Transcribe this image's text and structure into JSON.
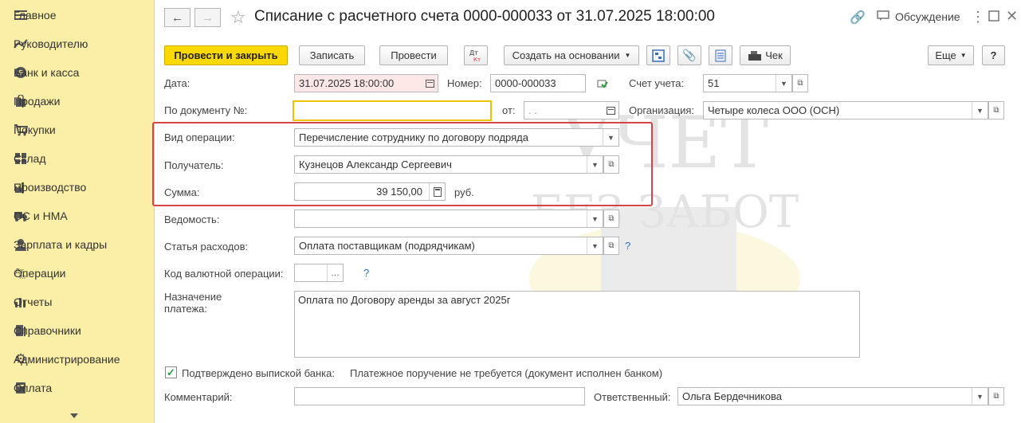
{
  "sidebar": {
    "items": [
      {
        "label": "Главное",
        "icon": "menu-icon"
      },
      {
        "label": "Руководителю",
        "icon": "trend-icon"
      },
      {
        "label": "Банк и касса",
        "icon": "ruble-coin-icon"
      },
      {
        "label": "Продажи",
        "icon": "bag-icon"
      },
      {
        "label": "Покупки",
        "icon": "cart-icon"
      },
      {
        "label": "Склад",
        "icon": "warehouse-icon"
      },
      {
        "label": "Производство",
        "icon": "factory-icon"
      },
      {
        "label": "ОС и НМА",
        "icon": "truck-icon"
      },
      {
        "label": "Зарплата и кадры",
        "icon": "person-icon"
      },
      {
        "label": "Операции",
        "icon": "dt-kt-icon"
      },
      {
        "label": "Отчеты",
        "icon": "bar-chart-icon"
      },
      {
        "label": "Справочники",
        "icon": "books-icon"
      },
      {
        "label": "Администрирование",
        "icon": "gear-icon"
      },
      {
        "label": "Оплата",
        "icon": "card-icon"
      }
    ]
  },
  "header": {
    "title": "Списание с расчетного счета 0000-000033 от 31.07.2025 18:00:00",
    "discuss_label": "Обсуждение"
  },
  "toolbar": {
    "post_close": "Провести и закрыть",
    "save": "Записать",
    "post": "Провести",
    "dtkt": "Дт Кт",
    "create_based": "Создать на основании",
    "check": "Чек",
    "more": "Еще",
    "help": "?"
  },
  "form": {
    "date_label": "Дата:",
    "date_value": "31.07.2025 18:00:00",
    "number_label": "Номер:",
    "number_value": "0000-000033",
    "account_label": "Счет учета:",
    "account_value": "51",
    "doc_no_label": "По документу №:",
    "doc_no_value": "",
    "from_label": "от:",
    "from_value": " .  .  ",
    "org_label": "Организация:",
    "org_value": "Четыре колеса ООО (ОСН)",
    "op_type_label": "Вид операции:",
    "op_type_value": "Перечисление сотруднику по договору подряда",
    "recipient_label": "Получатель:",
    "recipient_value": "Кузнецов Александр Сергеевич",
    "sum_label": "Сумма:",
    "sum_value": "39 150,00",
    "currency": "руб.",
    "statement_label": "Ведомость:",
    "statement_value": "",
    "expense_label": "Статья расходов:",
    "expense_value": "Оплата поставщикам (подрядчикам)",
    "fx_code_label": "Код валютной операции:",
    "fx_code_value": "",
    "purpose_label": "Назначение платежа:",
    "purpose_value": "Оплата по Договору аренды за август 2025г",
    "confirmed_label": "Подтверждено выпиской банка:",
    "confirmed_note": "Платежное поручение не требуется (документ исполнен банком)",
    "comment_label": "Комментарий:",
    "comment_value": "",
    "responsible_label": "Ответственный:",
    "responsible_value": "Ольга Бердечникова"
  },
  "watermark": {
    "line1": "УЧЕТ",
    "line2": "БЕЗ ЗАБОТ"
  },
  "colors": {
    "sidebar_bg": "#fbeea6",
    "primary_button": "#fbd800",
    "highlight_frame": "#d64545"
  }
}
